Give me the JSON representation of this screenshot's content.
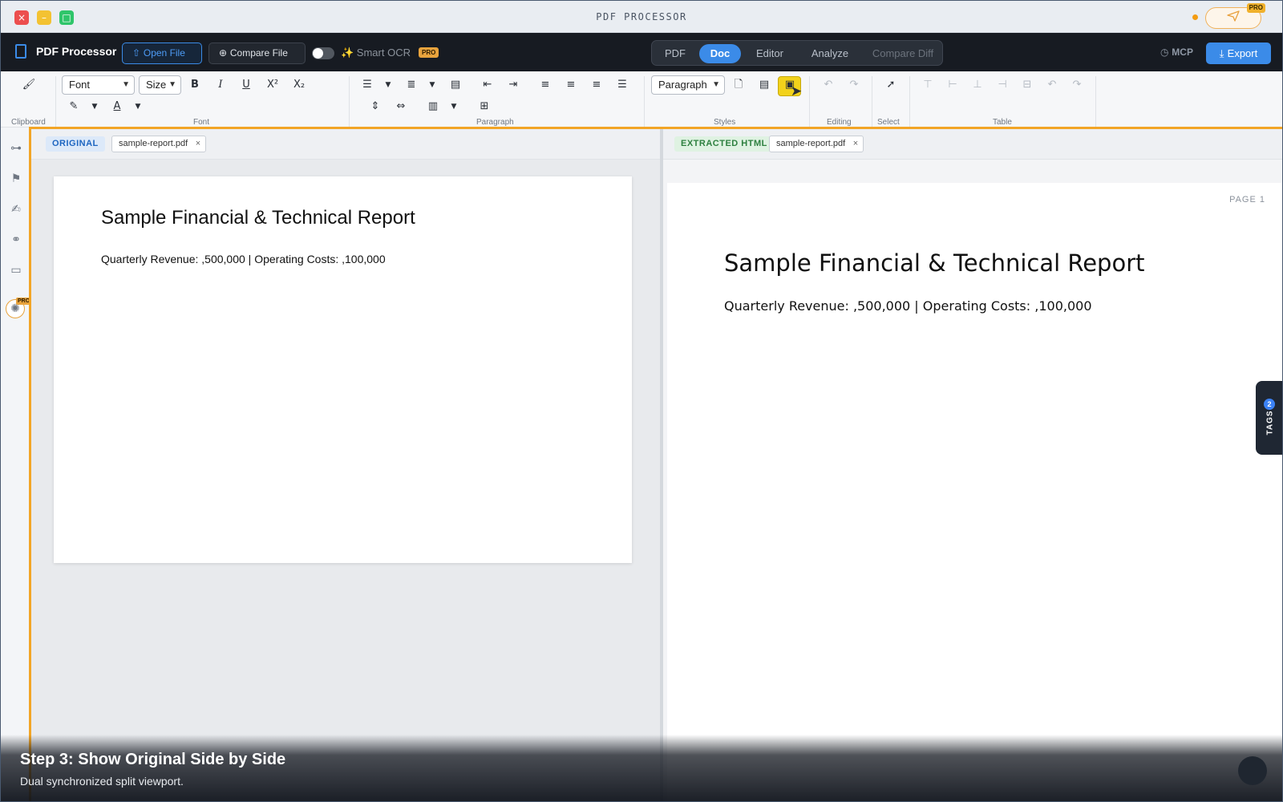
{
  "window": {
    "title": "PDF PROCESSOR",
    "pro_badge": "PRO"
  },
  "appbar": {
    "name": "PDF Processor",
    "open_file": "Open File",
    "compare_file": "Compare File",
    "smart_ocr": "✨ Smart OCR",
    "smart_ocr_enabled": false,
    "pro_badge": "PRO",
    "tabs": [
      {
        "label": "PDF"
      },
      {
        "label": "Doc",
        "active": true
      },
      {
        "label": "Editor"
      },
      {
        "label": "Analyze"
      },
      {
        "label": "Compare Diff",
        "disabled": true
      }
    ],
    "mcp": "MCP",
    "export": "Export"
  },
  "ribbon": {
    "font_select": "Font",
    "size_select": "Size",
    "paragraph_select": "Paragraph",
    "groups": {
      "clipboard": "Clipboard",
      "font": "Font",
      "paragraph": "Paragraph",
      "styles": "Styles",
      "editing": "Editing",
      "select": "Select",
      "table": "Table"
    }
  },
  "left_rail": {
    "pro_badge": "PRO"
  },
  "split": {
    "left": {
      "badge": "ORIGINAL",
      "file": "sample-report.pdf"
    },
    "right": {
      "badge": "EXTRACTED HTML",
      "file": "sample-report.pdf",
      "page_label": "PAGE 1"
    }
  },
  "document": {
    "title": "Sample Financial & Technical Report",
    "body": "Quarterly Revenue: ,500,000 | Operating Costs: ,100,000"
  },
  "tags": {
    "label": "TAGS",
    "count": "2"
  },
  "caption": {
    "title": "Step 3: Show Original Side by Side",
    "subtitle": "Dual synchronized split viewport."
  },
  "colors": {
    "accent": "#3b8be8",
    "highlight": "#f2a526",
    "pro": "#e8a33d"
  }
}
